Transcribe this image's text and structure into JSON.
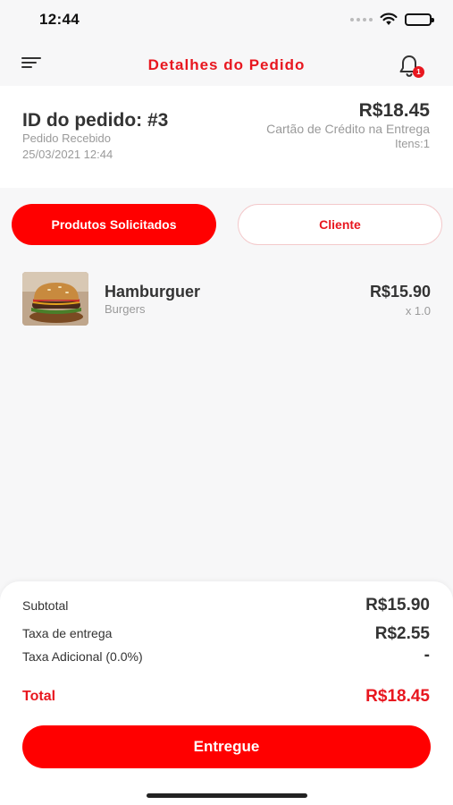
{
  "status_bar": {
    "time": "12:44"
  },
  "header": {
    "title": "Detalhes do Pedido",
    "notification_count": "1"
  },
  "order": {
    "id_label": "ID do pedido: #3",
    "status": "Pedido Recebido",
    "date": "25/03/2021 12:44",
    "total": "R$18.45",
    "payment_method": "Cartão de Crédito na Entrega",
    "items_count": "Itens:1"
  },
  "tabs": [
    {
      "label": "Produtos Solicitados",
      "active": true
    },
    {
      "label": "Cliente",
      "active": false
    }
  ],
  "products": [
    {
      "name": "Hamburguer",
      "category": "Burgers",
      "price": "R$15.90",
      "quantity": "x 1.0"
    }
  ],
  "summary": {
    "subtotal_label": "Subtotal",
    "subtotal_value": "R$15.90",
    "delivery_label": "Taxa de entrega",
    "delivery_value": "R$2.55",
    "additional_label": "Taxa Adicional (0.0%)",
    "additional_value": "-",
    "total_label": "Total",
    "total_value": "R$18.45"
  },
  "actions": {
    "deliver_label": "Entregue"
  },
  "colors": {
    "brand": "#e8171f",
    "button": "#ff0000"
  }
}
